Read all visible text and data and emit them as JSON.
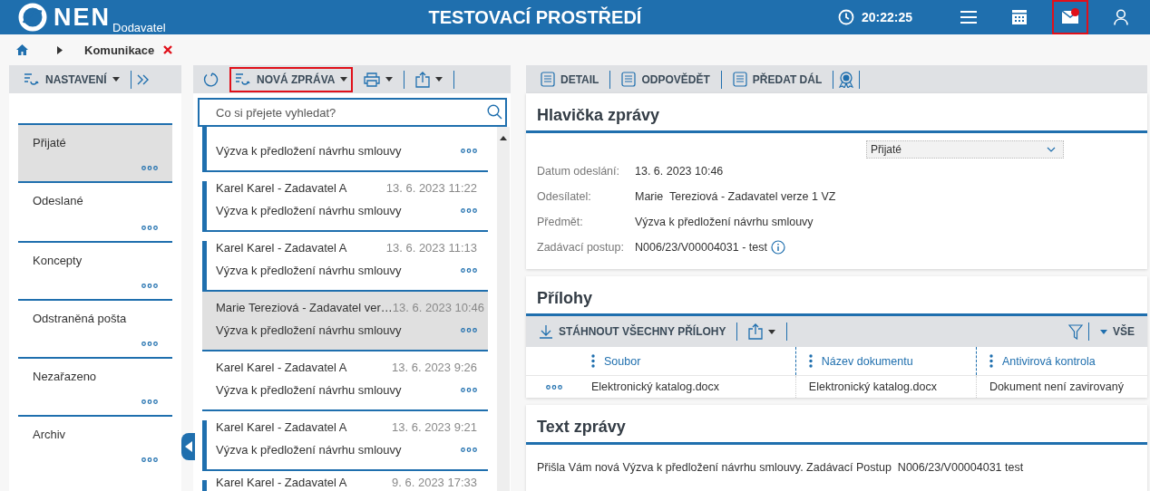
{
  "header": {
    "logo": "NEN",
    "logo_subtitle": "Dodavatel",
    "title": "TESTOVACÍ PROSTŘEDÍ",
    "time": "20:22:25",
    "mail": {
      "has_notification": true,
      "highlighted": true
    }
  },
  "breadcrumb": {
    "page": "Komunikace"
  },
  "folders_toolbar": {
    "settings": "NASTAVENÍ"
  },
  "folders": [
    {
      "label": "Přijaté",
      "selected": true
    },
    {
      "label": "Odeslané",
      "selected": false
    },
    {
      "label": "Koncepty",
      "selected": false
    },
    {
      "label": "Odstraněná pošta",
      "selected": false
    },
    {
      "label": "Nezařazeno",
      "selected": false
    },
    {
      "label": "Archiv",
      "selected": false
    }
  ],
  "messages_toolbar": {
    "new_message": {
      "label": "NOVÁ ZPRÁVA",
      "highlighted": true
    }
  },
  "search": {
    "placeholder": "Co si přejete vyhledat?"
  },
  "messages": [
    {
      "subject": "Výzva k předložení návrhu smlouvy",
      "unread": true,
      "selected": false
    },
    {
      "sender": "Karel Karel - Zadavatel A",
      "date": "13. 6. 2023 11:22",
      "subject": "Výzva k předložení návrhu smlouvy",
      "unread": true,
      "selected": false
    },
    {
      "sender": "Karel Karel - Zadavatel A",
      "date": "13. 6. 2023 11:13",
      "subject": "Výzva k předložení návrhu smlouvy",
      "unread": true,
      "selected": false
    },
    {
      "sender": "Marie Tereziová - Zadavatel ver…",
      "date": "13. 6. 2023 10:46",
      "subject": "Výzva k předložení návrhu smlouvy",
      "unread": false,
      "selected": true
    },
    {
      "sender": "Karel Karel - Zadavatel A",
      "date": "13. 6. 2023 9:26",
      "subject": "Výzva k předložení návrhu smlouvy",
      "unread": false,
      "selected": false
    },
    {
      "sender": "Karel Karel - Zadavatel A",
      "date": "13. 6. 2023 9:21",
      "subject": "Výzva k předložení návrhu smlouvy",
      "unread": true,
      "selected": false
    },
    {
      "sender": "Karel Karel - Zadavatel A",
      "date": "9. 6. 2023 17:33",
      "unread": true,
      "selected": false
    }
  ],
  "detail_toolbar": {
    "buttons": [
      "DETAIL",
      "ODPOVĚDĚT",
      "PŘEDAT DÁL"
    ]
  },
  "header_card": {
    "title": "Hlavička zprávy",
    "folder_select": "Přijaté",
    "fields": [
      {
        "label": "Datum odeslání:",
        "value": "13. 6. 2023 10:46",
        "info": false
      },
      {
        "label": "Odesílatel:",
        "value": "Marie  Tereziová - Zadavatel verze 1 VZ",
        "info": false
      },
      {
        "label": "Předmět:",
        "value": "Výzva k předložení návrhu smlouvy",
        "info": false
      },
      {
        "label": "Zadávací postup:",
        "value": "N006/23/V00004031 - test",
        "info": true
      }
    ]
  },
  "attachments": {
    "title": "Přílohy",
    "download_all": "STÁHNOUT VŠECHNY PŘÍLOHY",
    "filter_label": "VŠE",
    "columns": [
      "Soubor",
      "Název dokumentu",
      "Antivirová kontrola"
    ],
    "rows": [
      [
        "Elektronický katalog.docx",
        "Elektronický katalog.docx",
        "Dokument není zavirovaný"
      ]
    ]
  },
  "message_text": {
    "title": "Text zprávy",
    "body": "Přišla Vám nová Výzva k předložení návrhu smlouvy. Zadávací Postup  N006/23/V00004031 test"
  }
}
